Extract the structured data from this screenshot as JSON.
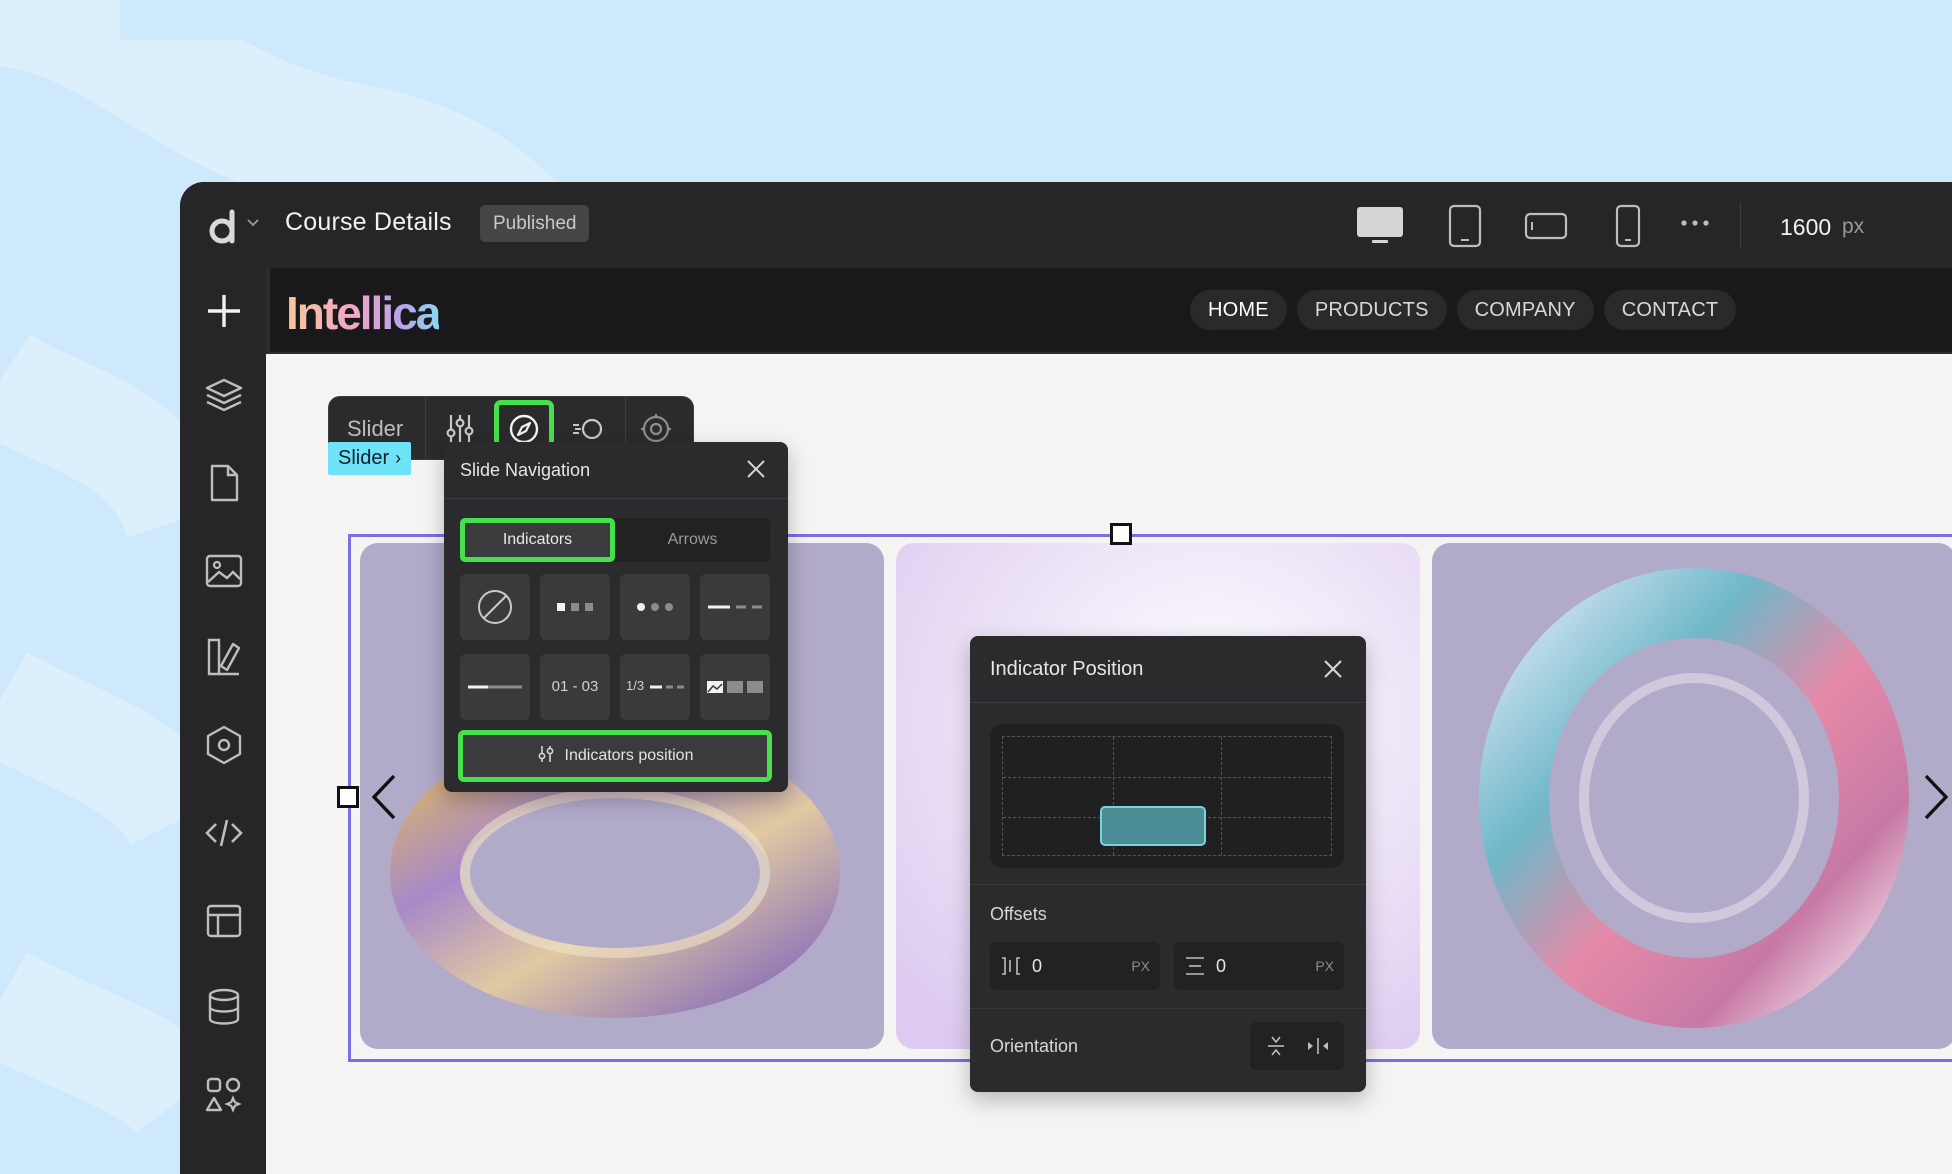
{
  "app": {
    "page_title": "Course Details",
    "status": "Published",
    "viewport_width": "1600",
    "viewport_unit": "px"
  },
  "icons": {
    "logo": "logo-mark-icon",
    "devices": [
      "desktop-icon",
      "tablet-icon",
      "tablet-landscape-icon",
      "mobile-icon",
      "more-icon"
    ],
    "sidebar": [
      "add-icon",
      "layers-icon",
      "pages-icon",
      "media-icon",
      "design-icon",
      "plugins-icon",
      "code-icon",
      "layout-icon",
      "database-icon",
      "apps-icon"
    ]
  },
  "site": {
    "brand": "Intellica",
    "nav": [
      "HOME",
      "PRODUCTS",
      "COMPANY",
      "CONTACT"
    ],
    "active_nav": "HOME"
  },
  "toolbar": {
    "label": "Slider",
    "active_tool": "navigation"
  },
  "breadcrumb": {
    "label": "Slider"
  },
  "slide_navigation": {
    "title": "Slide Navigation",
    "tabs": [
      "Indicators",
      "Arrows"
    ],
    "active_tab": "Indicators",
    "style_labels": {
      "numbers": "01 - 03",
      "fraction": "1/3"
    },
    "position_button": "Indicators position"
  },
  "indicator_position": {
    "title": "Indicator Position",
    "selected_cell": "bottom-center",
    "offsets_label": "Offsets",
    "offset_x": {
      "value": "0",
      "unit": "PX"
    },
    "offset_y": {
      "value": "0",
      "unit": "PX"
    },
    "orientation_label": "Orientation"
  },
  "colors": {
    "highlight": "#47e04d",
    "selection_frame": "#7a6ee6",
    "breadcrumb": "#6ee2f6",
    "grid_selected": "#4b8d95"
  }
}
